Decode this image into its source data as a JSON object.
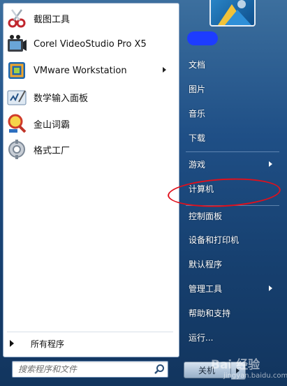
{
  "programs": [
    {
      "label": "截图工具",
      "icon": "scissors-icon",
      "has_arrow": false
    },
    {
      "label": "Corel VideoStudio Pro X5",
      "icon": "film-camera-icon",
      "has_arrow": false
    },
    {
      "label": "VMware Workstation",
      "icon": "vmware-icon",
      "has_arrow": true
    },
    {
      "label": "数学输入面板",
      "icon": "math-input-icon",
      "has_arrow": false
    },
    {
      "label": "金山词霸",
      "icon": "dictionary-magnifier-icon",
      "has_arrow": false
    },
    {
      "label": "格式工厂",
      "icon": "format-factory-icon",
      "has_arrow": false
    }
  ],
  "all_programs_label": "所有程序",
  "search": {
    "placeholder": "搜索程序和文件"
  },
  "right_items": [
    {
      "label": "文档",
      "has_arrow": false
    },
    {
      "label": "图片",
      "has_arrow": false
    },
    {
      "label": "音乐",
      "has_arrow": false
    },
    {
      "label": "下载",
      "has_arrow": false
    },
    {
      "label": "游戏",
      "has_arrow": true
    },
    {
      "label": "计算机",
      "has_arrow": false
    },
    {
      "label": "控制面板",
      "has_arrow": false
    },
    {
      "label": "设备和打印机",
      "has_arrow": false
    },
    {
      "label": "默认程序",
      "has_arrow": false
    },
    {
      "label": "管理工具",
      "has_arrow": true
    },
    {
      "label": "帮助和支持",
      "has_arrow": false
    },
    {
      "label": "运行...",
      "has_arrow": false
    }
  ],
  "shutdown": {
    "label": "关机"
  },
  "watermark": {
    "text": "Bai 经验",
    "sub": "jingyan.baidu.com"
  },
  "colors": {
    "annotation": "#e0101c",
    "redacted_name": "#1d3cff"
  }
}
